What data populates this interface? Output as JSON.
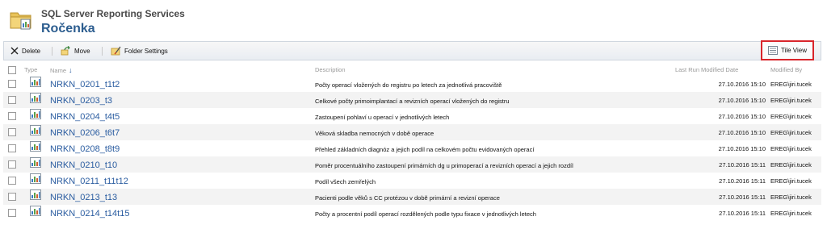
{
  "header": {
    "app_title": "SQL Server Reporting Services",
    "page_title": "Ročenka"
  },
  "toolbar": {
    "delete_label": "Delete",
    "move_label": "Move",
    "folder_settings_label": "Folder Settings",
    "tile_view_label": "Tile View"
  },
  "table": {
    "columns": {
      "type": "Type",
      "name": "Name",
      "description": "Description",
      "last_run": "Last Run",
      "modified_date": "Modified Date",
      "modified_by": "Modified By"
    },
    "rows": [
      {
        "name": "NRKN_0201_t1t2",
        "description": "Počty operací vložených do registru po letech za jednotlivá pracoviště",
        "modified_date": "27.10.2016 15:10",
        "modified_by": "EREG\\jiri.tucek"
      },
      {
        "name": "NRKN_0203_t3",
        "description": "Celkové počty primoimplantací a revizních operací vložených do registru",
        "modified_date": "27.10.2016 15:10",
        "modified_by": "EREG\\jiri.tucek"
      },
      {
        "name": "NRKN_0204_t4t5",
        "description": "Zastoupení pohlaví u operací v jednotlivých letech",
        "modified_date": "27.10.2016 15:10",
        "modified_by": "EREG\\jiri.tucek"
      },
      {
        "name": "NRKN_0206_t6t7",
        "description": "Věková skladba nemocných v době operace",
        "modified_date": "27.10.2016 15:10",
        "modified_by": "EREG\\jiri.tucek"
      },
      {
        "name": "NRKN_0208_t8t9",
        "description": "Přehled základních diagnóz a jejich podíl na celkovém počtu evidovaných operací",
        "modified_date": "27.10.2016 15:10",
        "modified_by": "EREG\\jiri.tucek"
      },
      {
        "name": "NRKN_0210_t10",
        "description": "Poměr procentuálního zastoupení primárních dg u primoperací a revizních operací a jejich rozdíl",
        "modified_date": "27.10.2016 15:11",
        "modified_by": "EREG\\jiri.tucek"
      },
      {
        "name": "NRKN_0211_t11t12",
        "description": "Podíl všech zemřelých",
        "modified_date": "27.10.2016 15:11",
        "modified_by": "EREG\\jiri.tucek"
      },
      {
        "name": "NRKN_0213_t13",
        "description": "Pacienti podle věků s CC protézou v době primární a revizní operace",
        "modified_date": "27.10.2016 15:11",
        "modified_by": "EREG\\jiri.tucek"
      },
      {
        "name": "NRKN_0214_t14t15",
        "description": "Počty a procentní podíl operací rozdělených podle typu fixace v jednotlivých letech",
        "modified_date": "27.10.2016 15:11",
        "modified_by": "EREG\\jiri.tucek"
      }
    ]
  }
}
